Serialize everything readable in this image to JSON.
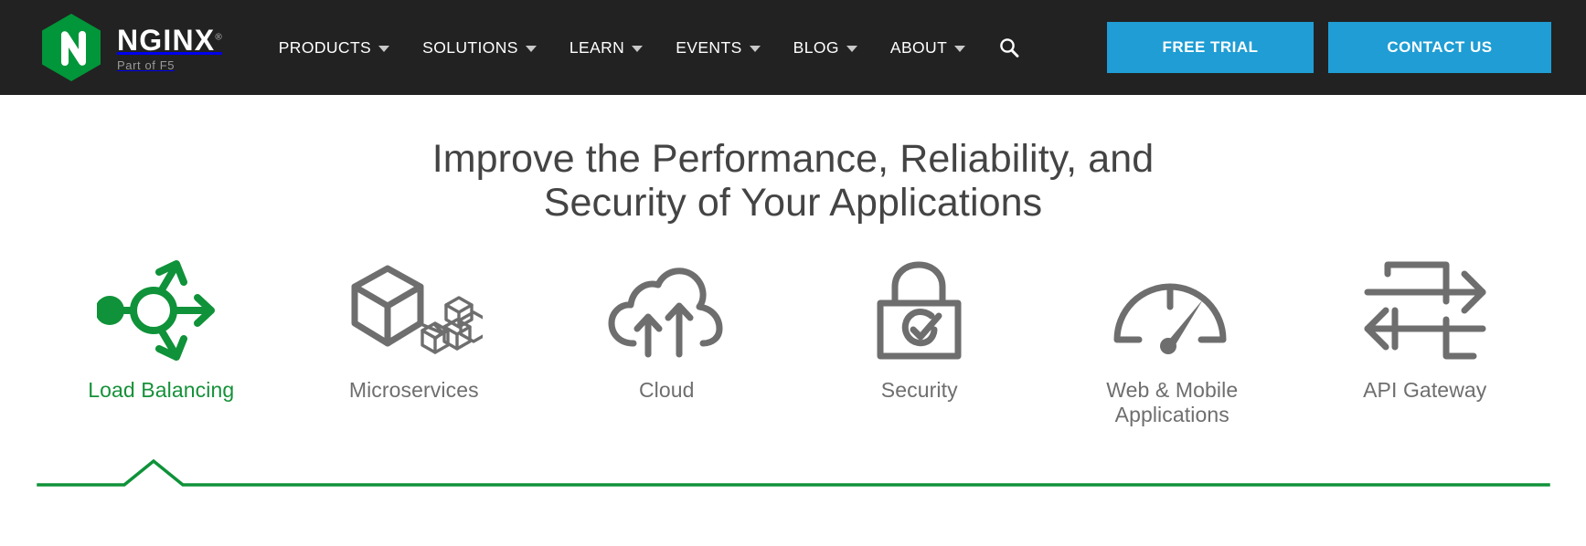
{
  "header": {
    "logo": {
      "icon": "nginx-hexagon-logo",
      "letter": "N",
      "hex_color": "#009639",
      "wordmark": "NGINX",
      "registered_mark": "®",
      "tagline": "Part of F5"
    },
    "nav_items": [
      {
        "label": "PRODUCTS",
        "has_dropdown": true
      },
      {
        "label": "SOLUTIONS",
        "has_dropdown": true
      },
      {
        "label": "LEARN",
        "has_dropdown": true
      },
      {
        "label": "EVENTS",
        "has_dropdown": true
      },
      {
        "label": "BLOG",
        "has_dropdown": true
      },
      {
        "label": "ABOUT",
        "has_dropdown": true
      }
    ],
    "search": {
      "icon": "search-icon"
    },
    "cta_primary": "FREE TRIAL",
    "cta_secondary": "CONTACT US",
    "bar_color": "#222222",
    "button_color": "#1f9dd4"
  },
  "hero": {
    "title_line1": "Improve the Performance, Reliability, and",
    "title_line2": "Security of Your Applications",
    "title_color": "#444444"
  },
  "tabs": {
    "active_index": 0,
    "active_color": "#159139",
    "inactive_color": "#6e6e6e",
    "items": [
      {
        "label": "Load Balancing",
        "icon": "load-balancing-icon",
        "active": true
      },
      {
        "label": "Microservices",
        "icon": "microservices-cube-icon",
        "active": false
      },
      {
        "label": "Cloud",
        "icon": "cloud-upload-icon",
        "active": false
      },
      {
        "label": "Security",
        "icon": "lock-check-icon",
        "active": false
      },
      {
        "label": "Web & Mobile\nApplications",
        "label_line1": "Web & Mobile",
        "label_line2": "Applications",
        "icon": "speedometer-gauge-icon",
        "active": false
      },
      {
        "label": "API Gateway",
        "icon": "api-gateway-arrows-icon",
        "active": false
      }
    ]
  }
}
